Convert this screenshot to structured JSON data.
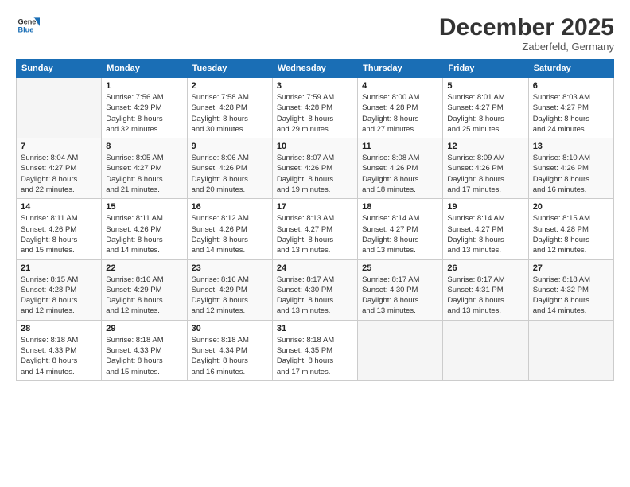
{
  "logo": {
    "line1": "General",
    "line2": "Blue"
  },
  "title": "December 2025",
  "location": "Zaberfeld, Germany",
  "weekdays": [
    "Sunday",
    "Monday",
    "Tuesday",
    "Wednesday",
    "Thursday",
    "Friday",
    "Saturday"
  ],
  "weeks": [
    [
      {
        "day": "",
        "empty": true
      },
      {
        "day": "1",
        "sunrise": "7:56 AM",
        "sunset": "4:29 PM",
        "daylight": "8 hours and 32 minutes."
      },
      {
        "day": "2",
        "sunrise": "7:58 AM",
        "sunset": "4:28 PM",
        "daylight": "8 hours and 30 minutes."
      },
      {
        "day": "3",
        "sunrise": "7:59 AM",
        "sunset": "4:28 PM",
        "daylight": "8 hours and 29 minutes."
      },
      {
        "day": "4",
        "sunrise": "8:00 AM",
        "sunset": "4:28 PM",
        "daylight": "8 hours and 27 minutes."
      },
      {
        "day": "5",
        "sunrise": "8:01 AM",
        "sunset": "4:27 PM",
        "daylight": "8 hours and 25 minutes."
      },
      {
        "day": "6",
        "sunrise": "8:03 AM",
        "sunset": "4:27 PM",
        "daylight": "8 hours and 24 minutes."
      }
    ],
    [
      {
        "day": "7",
        "sunrise": "8:04 AM",
        "sunset": "4:27 PM",
        "daylight": "8 hours and 22 minutes."
      },
      {
        "day": "8",
        "sunrise": "8:05 AM",
        "sunset": "4:27 PM",
        "daylight": "8 hours and 21 minutes."
      },
      {
        "day": "9",
        "sunrise": "8:06 AM",
        "sunset": "4:26 PM",
        "daylight": "8 hours and 20 minutes."
      },
      {
        "day": "10",
        "sunrise": "8:07 AM",
        "sunset": "4:26 PM",
        "daylight": "8 hours and 19 minutes."
      },
      {
        "day": "11",
        "sunrise": "8:08 AM",
        "sunset": "4:26 PM",
        "daylight": "8 hours and 18 minutes."
      },
      {
        "day": "12",
        "sunrise": "8:09 AM",
        "sunset": "4:26 PM",
        "daylight": "8 hours and 17 minutes."
      },
      {
        "day": "13",
        "sunrise": "8:10 AM",
        "sunset": "4:26 PM",
        "daylight": "8 hours and 16 minutes."
      }
    ],
    [
      {
        "day": "14",
        "sunrise": "8:11 AM",
        "sunset": "4:26 PM",
        "daylight": "8 hours and 15 minutes."
      },
      {
        "day": "15",
        "sunrise": "8:11 AM",
        "sunset": "4:26 PM",
        "daylight": "8 hours and 14 minutes."
      },
      {
        "day": "16",
        "sunrise": "8:12 AM",
        "sunset": "4:26 PM",
        "daylight": "8 hours and 14 minutes."
      },
      {
        "day": "17",
        "sunrise": "8:13 AM",
        "sunset": "4:27 PM",
        "daylight": "8 hours and 13 minutes."
      },
      {
        "day": "18",
        "sunrise": "8:14 AM",
        "sunset": "4:27 PM",
        "daylight": "8 hours and 13 minutes."
      },
      {
        "day": "19",
        "sunrise": "8:14 AM",
        "sunset": "4:27 PM",
        "daylight": "8 hours and 13 minutes."
      },
      {
        "day": "20",
        "sunrise": "8:15 AM",
        "sunset": "4:28 PM",
        "daylight": "8 hours and 12 minutes."
      }
    ],
    [
      {
        "day": "21",
        "sunrise": "8:15 AM",
        "sunset": "4:28 PM",
        "daylight": "8 hours and 12 minutes."
      },
      {
        "day": "22",
        "sunrise": "8:16 AM",
        "sunset": "4:29 PM",
        "daylight": "8 hours and 12 minutes."
      },
      {
        "day": "23",
        "sunrise": "8:16 AM",
        "sunset": "4:29 PM",
        "daylight": "8 hours and 12 minutes."
      },
      {
        "day": "24",
        "sunrise": "8:17 AM",
        "sunset": "4:30 PM",
        "daylight": "8 hours and 13 minutes."
      },
      {
        "day": "25",
        "sunrise": "8:17 AM",
        "sunset": "4:30 PM",
        "daylight": "8 hours and 13 minutes."
      },
      {
        "day": "26",
        "sunrise": "8:17 AM",
        "sunset": "4:31 PM",
        "daylight": "8 hours and 13 minutes."
      },
      {
        "day": "27",
        "sunrise": "8:18 AM",
        "sunset": "4:32 PM",
        "daylight": "8 hours and 14 minutes."
      }
    ],
    [
      {
        "day": "28",
        "sunrise": "8:18 AM",
        "sunset": "4:33 PM",
        "daylight": "8 hours and 14 minutes."
      },
      {
        "day": "29",
        "sunrise": "8:18 AM",
        "sunset": "4:33 PM",
        "daylight": "8 hours and 15 minutes."
      },
      {
        "day": "30",
        "sunrise": "8:18 AM",
        "sunset": "4:34 PM",
        "daylight": "8 hours and 16 minutes."
      },
      {
        "day": "31",
        "sunrise": "8:18 AM",
        "sunset": "4:35 PM",
        "daylight": "8 hours and 17 minutes."
      },
      {
        "day": "",
        "empty": true
      },
      {
        "day": "",
        "empty": true
      },
      {
        "day": "",
        "empty": true
      }
    ]
  ],
  "labels": {
    "sunrise": "Sunrise: ",
    "sunset": "Sunset: ",
    "daylight": "Daylight: "
  }
}
